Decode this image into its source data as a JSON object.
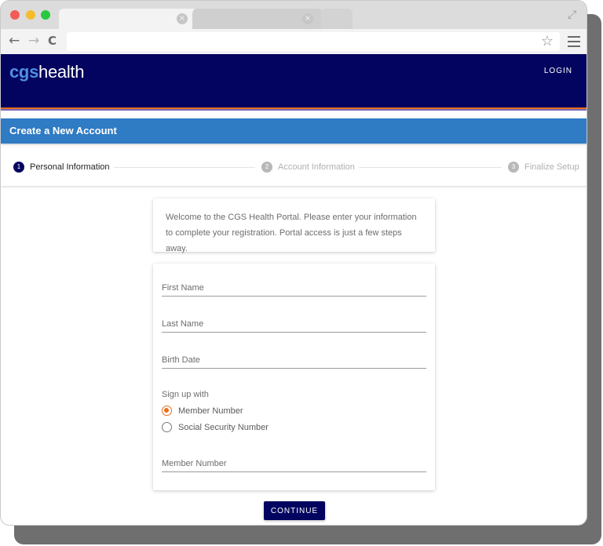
{
  "browser": {
    "tab_close_glyph": "×",
    "back_glyph": "←",
    "forward_glyph": "→",
    "reload_glyph": "C",
    "bookmark_glyph": "☆",
    "expand_glyph": "⤢"
  },
  "header": {
    "logo_cgs": "cgs",
    "logo_health": "health",
    "login": "LOGIN"
  },
  "page": {
    "title": "Create a New Account"
  },
  "steps": [
    {
      "number": "1",
      "label": "Personal Information"
    },
    {
      "number": "2",
      "label": "Account Information"
    },
    {
      "number": "3",
      "label": "Finalize Setup"
    }
  ],
  "welcome": {
    "text": "Welcome to the CGS Health Portal. Please enter your information to complete your registration. Portal access is just a few steps away."
  },
  "form": {
    "first_name_placeholder": "First Name",
    "last_name_placeholder": "Last Name",
    "birth_date_placeholder": "Birth Date",
    "signup_label": "Sign up with",
    "options": [
      "Member Number",
      "Social Security Number"
    ],
    "selected_option": "Member Number",
    "member_number_placeholder": "Member Number"
  },
  "actions": {
    "continue": "CONTINUE"
  },
  "colors": {
    "header_navy": "#03045f",
    "title_blue": "#2f7bc4",
    "accent_orange": "#e86f1c",
    "logo_blue": "#4f8fe0"
  }
}
